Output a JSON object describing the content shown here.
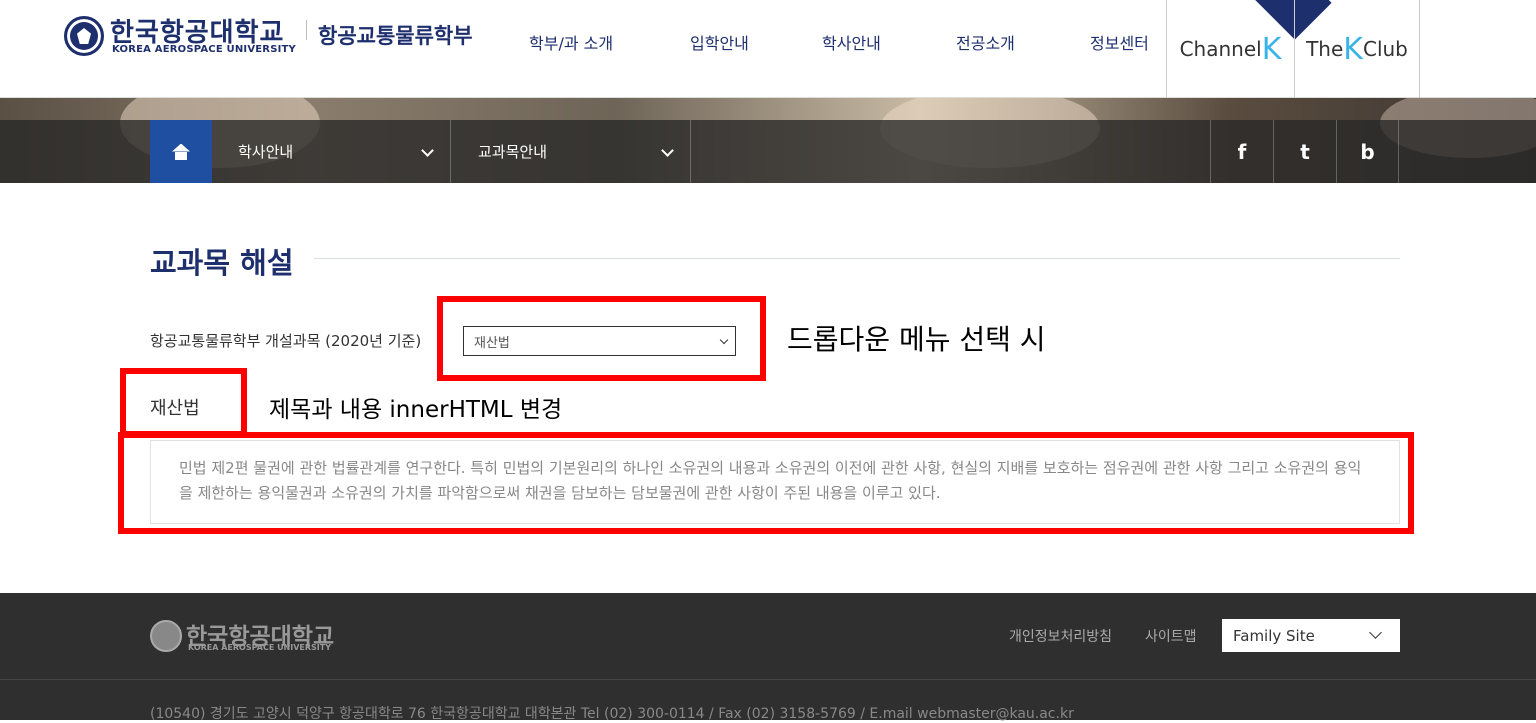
{
  "header": {
    "logo_kr": "한국항공대학교",
    "logo_en": "KOREA AEROSPACE UNIVERSITY",
    "department": "항공교통물류학부",
    "nav": [
      "학부/과 소개",
      "입학안내",
      "학사안내",
      "전공소개",
      "정보센터"
    ],
    "channel_k": {
      "prefix": "Channel",
      "k": "K"
    },
    "the_k_club": {
      "prefix": "The",
      "k": "K",
      "suffix": "Club"
    }
  },
  "breadcrumb": {
    "level1": "학사안내",
    "level2": "교과목안내"
  },
  "sns": {
    "facebook": "f",
    "twitter": "t",
    "blog": "b"
  },
  "content": {
    "page_title": "교과목 해설",
    "select_label": "항공교통물류학부 개설과목 (2020년 기준)",
    "selected_course": "재산법",
    "course_title": "재산법",
    "description": "민법 제2편 물권에 관한 법률관계를 연구한다. 특히 민법의 기본원리의 하나인 소유권의 내용과 소유권의 이전에 관한 사항, 현실의 지배를 보호하는 점유권에 관한 사항 그리고 소유권의 용익을 제한하는 용익물권과 소유권의 가치를 파악함으로써 채권을 담보하는 담보물권에 관한 사항이 주된 내용을 이루고 있다."
  },
  "annotations": {
    "dropdown_note": "드롭다운 메뉴 선택 시",
    "change_note": "제목과 내용 innerHTML 변경",
    "color": "#ff0000"
  },
  "footer": {
    "logo_kr": "한국항공대학교",
    "logo_en": "KOREA AEROSPACE UNIVERSITY",
    "privacy": "개인정보처리방침",
    "sitemap": "사이트맵",
    "family_site": "Family Site",
    "address": "(10540) 경기도 고양시 덕양구 항공대학로 76 한국항공대학교 대학본관 Tel (02) 300-0114 / Fax (02) 3158-5769 / E.mail webmaster@kau.ac.kr"
  },
  "colors": {
    "brand_navy": "#1e2f6e",
    "home_blue": "#1e4fa0",
    "k_accent": "#3ab4e6",
    "footer_bg": "#2f2f2f"
  }
}
